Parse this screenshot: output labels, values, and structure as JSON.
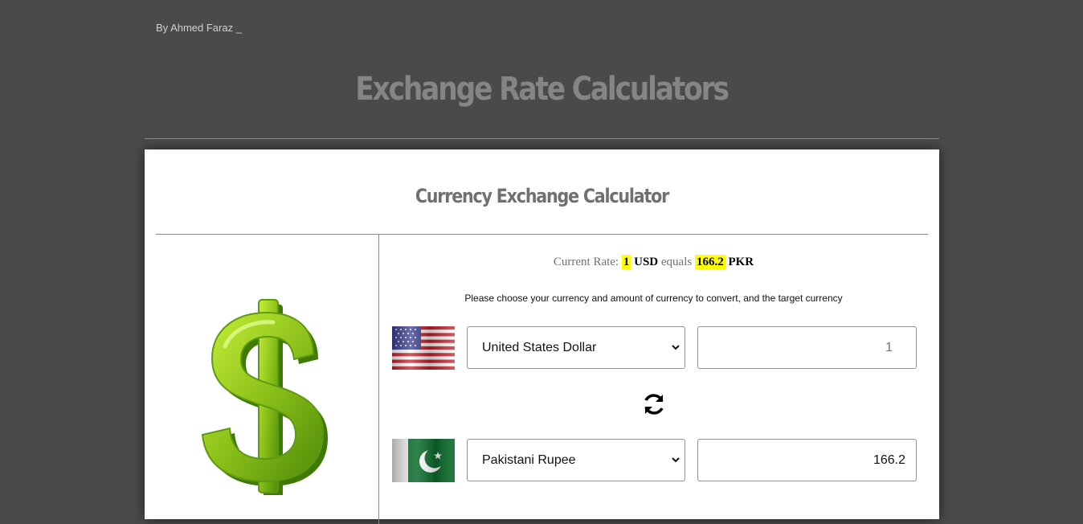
{
  "header": {
    "byline": "By Ahmed Faraz _",
    "title": "Exchange Rate Calculators"
  },
  "card": {
    "title": "Currency Exchange Calculator",
    "rate": {
      "prefix": "Current Rate:",
      "from_amount": "1",
      "from_code": "USD",
      "equals": "equals",
      "to_amount": "166.2",
      "to_code": "PKR"
    },
    "instructions": "Please choose your currency and amount of currency to convert, and the target currency",
    "from": {
      "currency": "United States Dollar",
      "amount": "1",
      "flag_icon": "us-flag-icon"
    },
    "to": {
      "currency": "Pakistani Rupee",
      "amount": "166.2",
      "flag_icon": "pakistan-flag-icon"
    },
    "swap_icon": "sync-icon",
    "illustration": "dollar-sign-icon"
  },
  "colors": {
    "background": "#4a4a4a",
    "highlight": "#ffff00",
    "dollar_green": "#8cc11a",
    "title_gray": "#858585"
  }
}
